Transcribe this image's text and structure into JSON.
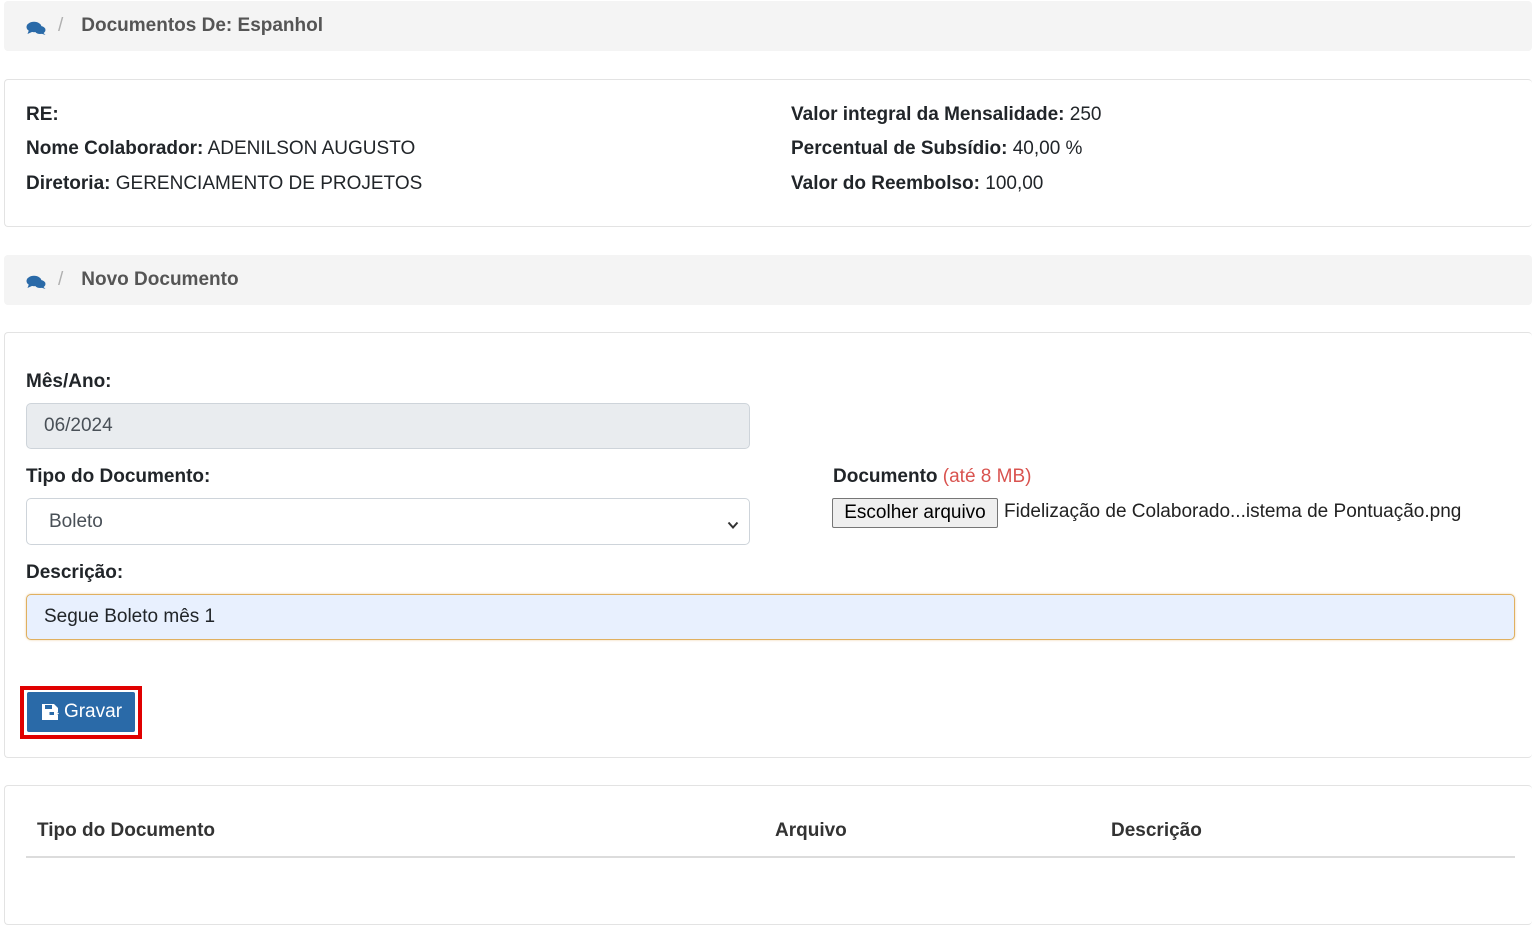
{
  "breadcrumbs": {
    "top": {
      "icon": "comments-icon",
      "separator": "/",
      "title": "Documentos De: Espanhol"
    },
    "middle": {
      "icon": "comments-icon",
      "separator": "/",
      "title": "Novo Documento"
    }
  },
  "info": {
    "re_label": "RE:",
    "re_value": "",
    "nome_label": "Nome Colaborador:",
    "nome_value": "ADENILSON AUGUSTO",
    "diretoria_label": "Diretoria:",
    "diretoria_value": "GERENCIAMENTO DE PROJETOS",
    "mensalidade_label": "Valor integral da Mensalidade:",
    "mensalidade_value": "250",
    "subsidio_label": "Percentual de Subsídio:",
    "subsidio_value": "40,00 %",
    "reembolso_label": "Valor do Reembolso:",
    "reembolso_value": "100,00"
  },
  "form": {
    "mes_ano_label": "Mês/Ano:",
    "mes_ano_value": "06/2024",
    "tipo_label": "Tipo do Documento:",
    "tipo_value": "Boleto",
    "documento_label": "Documento",
    "documento_hint": "(até 8 MB)",
    "file_button_label": "Escolher arquivo",
    "file_name": "Fidelização de Colaborado...istema de Pontuação.png",
    "descricao_label": "Descrição:",
    "descricao_value": "Segue Boleto mês 1",
    "save_label": "Gravar",
    "save_icon": "save-icon"
  },
  "table": {
    "headers": [
      "Tipo do Documento",
      "Arquivo",
      "Descrição"
    ]
  },
  "colors": {
    "primary_button": "#2a6aa8",
    "highlight_border": "#e00000",
    "hint_text": "#d9534f",
    "breadcrumb_icon": "#2a6aa8"
  }
}
